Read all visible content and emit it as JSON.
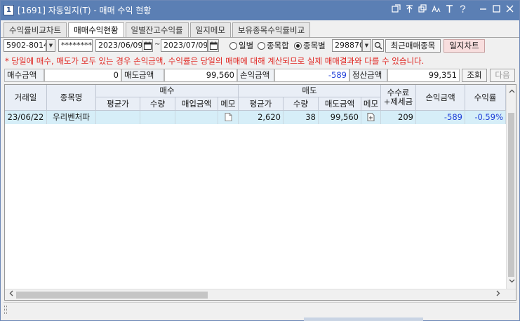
{
  "window": {
    "number": "1",
    "title": "[1691] 자동일지(T) - 매매 수익 현황",
    "accent_color": "#5b7fb4"
  },
  "tabs": [
    {
      "label": "수익률비교차트",
      "active": false
    },
    {
      "label": "매매수익현황",
      "active": true
    },
    {
      "label": "일별잔고수익률",
      "active": false
    },
    {
      "label": "일지메모",
      "active": false
    },
    {
      "label": "보유종목수익률비교",
      "active": false
    }
  ],
  "controls": {
    "account": "5902-8014",
    "password": "********",
    "start_date": "2023/06/09",
    "end_date": "2023/07/09",
    "date_separator": "~",
    "radios": [
      {
        "label": "일별",
        "selected": false
      },
      {
        "label": "종목합",
        "selected": false
      },
      {
        "label": "종목별",
        "selected": true
      }
    ],
    "stock_code": "298870",
    "recent_button": "최근매매종목",
    "chart_button": "일지차트"
  },
  "notice": "* 당일에 매수, 매도가 모두 있는 경우 손익금액, 수익률은 당일의 매매에 대해 계산되므로 실제 매매결과와 다를 수 있습니다.",
  "summary": {
    "buy_label": "매수금액",
    "buy_value": "0",
    "sell_label": "매도금액",
    "sell_value": "99,560",
    "pnl_label": "손익금액",
    "pnl_value": "-589",
    "settle_label": "정산금액",
    "settle_value": "99,351",
    "query_button": "조회",
    "next_button": "다음"
  },
  "table": {
    "headers": {
      "date": "거래일",
      "name": "종목명",
      "buy_group": "매수",
      "sell_group": "매도",
      "fee": "수수료\n+제세금",
      "pnl": "손익금액",
      "rate": "수익률",
      "buy_sub": [
        "평균가",
        "수량",
        "매입금액",
        "메모"
      ],
      "sell_sub": [
        "평균가",
        "수량",
        "매도금액",
        "메모"
      ]
    },
    "rows": [
      {
        "date": "23/06/22",
        "name": "우리벤처파",
        "buy_avg": "",
        "buy_qty": "",
        "buy_amount": "",
        "sell_avg": "2,620",
        "sell_qty": "38",
        "sell_amount": "99,560",
        "fee": "209",
        "pnl": "-589",
        "rate": "-0.59%"
      }
    ]
  },
  "colors": {
    "notice": "#e0241f",
    "negative": "#1f3fd8",
    "row_highlight": "#d6eef8",
    "header_bg": "#e9eef6"
  }
}
